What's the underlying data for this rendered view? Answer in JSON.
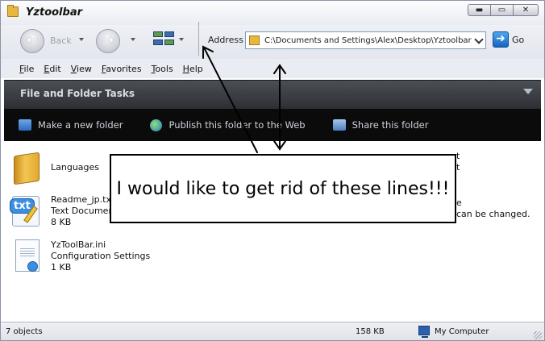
{
  "window": {
    "title": "Yztoolbar",
    "buttons": [
      "▬",
      "▭",
      "✕"
    ]
  },
  "toolbar": {
    "back_label": "Back",
    "back_glyph": "←",
    "forward_glyph": "→",
    "address_label": "Address",
    "address_value": "C:\\Documents and Settings\\Alex\\Desktop\\Yztoolbar",
    "go_label": "Go",
    "go_glyph": "➜"
  },
  "menu": {
    "items": [
      "File",
      "Edit",
      "View",
      "Favorites",
      "Tools",
      "Help"
    ]
  },
  "task_pane": {
    "title": "File and Folder Tasks",
    "tasks": [
      {
        "label": "Make a new folder",
        "icon": "new-folder-icon"
      },
      {
        "label": "Publish this folder to the Web",
        "icon": "globe-icon"
      },
      {
        "label": "Share this folder",
        "icon": "share-folder-icon"
      }
    ]
  },
  "files": [
    {
      "name": "Languages",
      "type": "",
      "size": "",
      "icon": "folder-icon"
    },
    {
      "name": "Readme_jp.txt",
      "type": "Text Document",
      "size": "8 KB",
      "icon": "text-document-icon"
    },
    {
      "name": "YzToolBar.ini",
      "type": "Configuration Settings",
      "size": "1 KB",
      "icon": "config-file-icon"
    }
  ],
  "partial_text": {
    "right_fragment_1": "t",
    "right_fragment_2": "t",
    "right_fragment_3": "e",
    "right_fragment_4": "can be changed."
  },
  "annotation": {
    "text": "I would like to get rid of these lines!!!"
  },
  "statusbar": {
    "objects": "7 objects",
    "size": "158 KB",
    "location": "My Computer"
  }
}
